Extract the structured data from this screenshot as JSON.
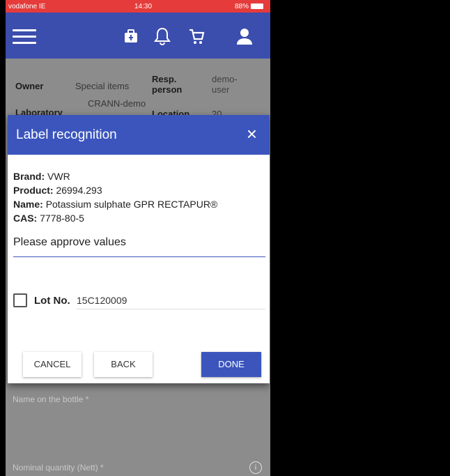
{
  "status_bar": {
    "carrier": "vodafone IE",
    "time": "14:30",
    "battery": "88%"
  },
  "app_bar": {
    "icons": [
      "menu-icon",
      "medkit-icon",
      "bell-icon",
      "cart-icon",
      "user-icon"
    ]
  },
  "background": {
    "owner_label": "Owner",
    "owner_value": "Special items",
    "resp_label": "Resp. person",
    "resp_value": "demo-user",
    "laboratory_label": "Laboratory",
    "laboratory_value": "CRANN-demo",
    "location_label": "Location",
    "location_value": "20",
    "name_placeholder": "Name on the bottle *",
    "quantity_placeholder": "Nominal quantity (Nett) *"
  },
  "dialog": {
    "title": "Label recognition",
    "close": "×",
    "brand_label": "Brand:",
    "brand_value": "VWR",
    "product_label": "Product:",
    "product_value": "26994.293",
    "name_label": "Name:",
    "name_value": "Potassium sulphate GPR RECTAPUR®",
    "cas_label": "CAS:",
    "cas_value": "7778-80-5",
    "approve_text": "Please approve values",
    "lot_label": "Lot No.",
    "lot_value": "15C120009",
    "lot_checked": false,
    "buttons": {
      "cancel": "CANCEL",
      "back": "BACK",
      "done": "DONE"
    }
  },
  "colors": {
    "primary": "#3b55bd",
    "appbar": "#3b4dad",
    "status": "#e53b3b"
  }
}
